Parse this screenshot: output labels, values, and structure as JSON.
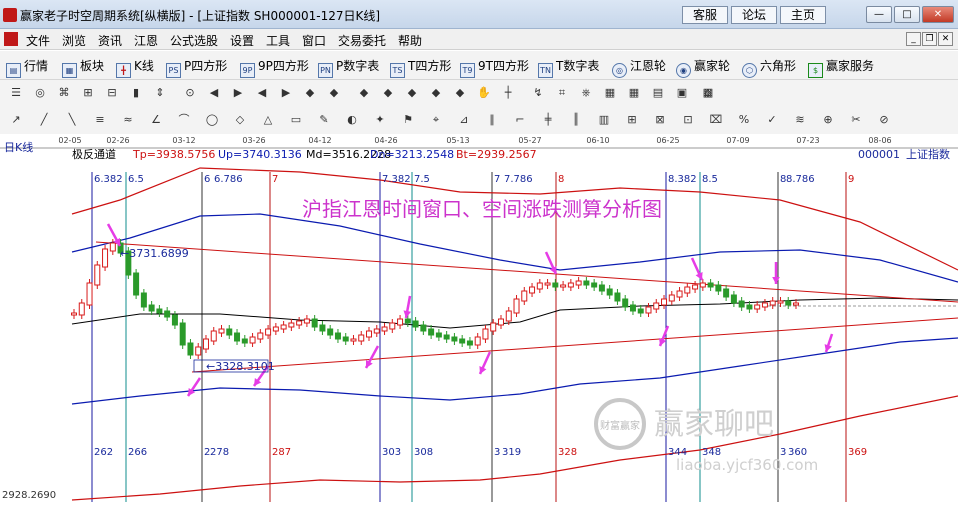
{
  "window": {
    "title": "赢家老子时空周期系统[纵横版] - [上证指数  SH000001-127日K线]",
    "top_buttons": [
      "客服",
      "论坛",
      "主页"
    ],
    "controls": {
      "minimize": "—",
      "maximize": "□",
      "close": "✕"
    }
  },
  "menu": {
    "items": [
      "文件",
      "浏览",
      "资讯",
      "江恩",
      "公式选股",
      "设置",
      "工具",
      "窗口",
      "交易委托",
      "帮助"
    ],
    "mdi": {
      "minimize": "_",
      "restore": "❐",
      "close": "✕"
    }
  },
  "toolbar_main": {
    "items": [
      {
        "icon": "quote-icon",
        "glyph": "▤",
        "label": "行情"
      },
      {
        "icon": "sector-icon",
        "glyph": "▦",
        "label": "板块"
      },
      {
        "icon": "kline-icon",
        "glyph": "╋",
        "label": "K线"
      },
      {
        "icon": "p-square-icon",
        "glyph": "PS",
        "label": "P四方形"
      },
      {
        "icon": "9p-square-icon",
        "glyph": "9P",
        "label": "9P四方形"
      },
      {
        "icon": "p-number-icon",
        "glyph": "PN",
        "label": "P数字表"
      },
      {
        "icon": "t-square-icon",
        "glyph": "TS",
        "label": "T四方形"
      },
      {
        "icon": "9t-square-icon",
        "glyph": "T9",
        "label": "9T四方形"
      },
      {
        "icon": "t-number-icon",
        "glyph": "TN",
        "label": "T数字表"
      },
      {
        "icon": "gann-wheel-icon",
        "glyph": "◎",
        "label": "江恩轮"
      },
      {
        "icon": "winner-wheel-icon",
        "glyph": "◉",
        "label": "赢家轮"
      },
      {
        "icon": "hexagon-icon",
        "glyph": "⬡",
        "label": "六角形"
      },
      {
        "icon": "winner-service-icon",
        "glyph": "$",
        "label": "赢家服务"
      }
    ]
  },
  "chart": {
    "period_label": "日K线",
    "indicator_name": "极反通道",
    "params": {
      "tp": "Tp=3938.5756",
      "up": "Up=3740.3136",
      "md": "Md=3516.2228",
      "dn": "Dn=3213.2548",
      "bt": "Bt=2939.2567"
    },
    "stock_code": "000001",
    "stock_name": "上证指数",
    "annotation_title": "沪指江恩时间窗口、空间涨跌测算分析图",
    "high_label": "3731.6899",
    "low_label": "3328.3101",
    "bottom_left_value": "2928.2690",
    "watermark_main": "赢家聊吧",
    "watermark_sub": "liaoba.yjcf360.com",
    "watermark_badge": "财富赢家",
    "top_dates": [
      "02-05",
      "02-26",
      "03-12",
      "03-26",
      "04-12",
      "04-26",
      "05-13",
      "05-27",
      "06-10",
      "06-25",
      "07-09",
      "07-23",
      "08-06"
    ],
    "time_windows_top": [
      "6.382",
      "6.5",
      "6",
      "6.786",
      "7",
      "7.382",
      "7.5",
      "7",
      "7.786",
      "8",
      "8.382",
      "8.5",
      "8",
      "8.786",
      "9"
    ],
    "time_windows_bottom": [
      "262",
      "266",
      "2",
      "278",
      "287",
      "303",
      "308",
      "3",
      "319",
      "328",
      "344",
      "348",
      "3",
      "360",
      "369"
    ],
    "colors": {
      "up_candle": "#d81a1a",
      "down_candle": "#2a9a2a",
      "outer_band": "#cc1111",
      "mid_band": "#0b1bb0",
      "center_line": "#000000",
      "window_line_blue": "#1a1aa0",
      "window_line_red": "#b81010",
      "window_line_teal": "#0f8c8c",
      "window_line_gray": "#333333",
      "arrow_magenta": "#e63ce6",
      "axis_text_blue": "#1a2a9c",
      "axis_text_red": "#cc1111"
    }
  }
}
